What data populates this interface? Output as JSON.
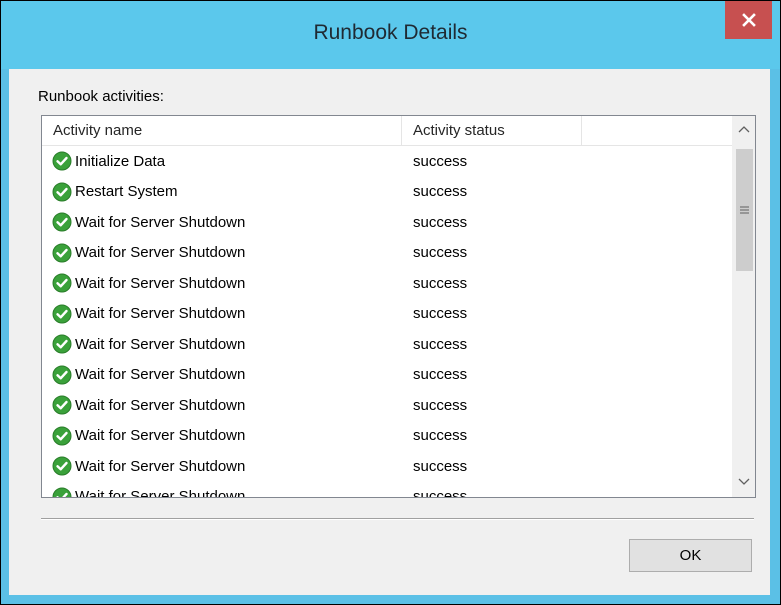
{
  "window": {
    "title": "Runbook Details",
    "close_glyph": "x"
  },
  "content": {
    "section_label": "Runbook activities:"
  },
  "list": {
    "columns": [
      "Activity name",
      "Activity status"
    ],
    "rows": [
      {
        "name": "Initialize Data",
        "status": "success",
        "icon": "check-circle-icon"
      },
      {
        "name": "Restart System",
        "status": "success",
        "icon": "check-circle-icon"
      },
      {
        "name": "Wait for Server Shutdown",
        "status": "success",
        "icon": "check-circle-icon"
      },
      {
        "name": "Wait for Server Shutdown",
        "status": "success",
        "icon": "check-circle-icon"
      },
      {
        "name": "Wait for Server Shutdown",
        "status": "success",
        "icon": "check-circle-icon"
      },
      {
        "name": "Wait for Server Shutdown",
        "status": "success",
        "icon": "check-circle-icon"
      },
      {
        "name": "Wait for Server Shutdown",
        "status": "success",
        "icon": "check-circle-icon"
      },
      {
        "name": "Wait for Server Shutdown",
        "status": "success",
        "icon": "check-circle-icon"
      },
      {
        "name": "Wait for Server Shutdown",
        "status": "success",
        "icon": "check-circle-icon"
      },
      {
        "name": "Wait for Server Shutdown",
        "status": "success",
        "icon": "check-circle-icon"
      },
      {
        "name": "Wait for Server Shutdown",
        "status": "success",
        "icon": "check-circle-icon"
      },
      {
        "name": "Wait for Server Shutdown",
        "status": "success",
        "icon": "check-circle-icon"
      }
    ]
  },
  "buttons": {
    "ok_label": "OK"
  },
  "colors": {
    "titlebar": "#5bc8ec",
    "close_button": "#c75050",
    "success_green": "#3aa13a"
  }
}
